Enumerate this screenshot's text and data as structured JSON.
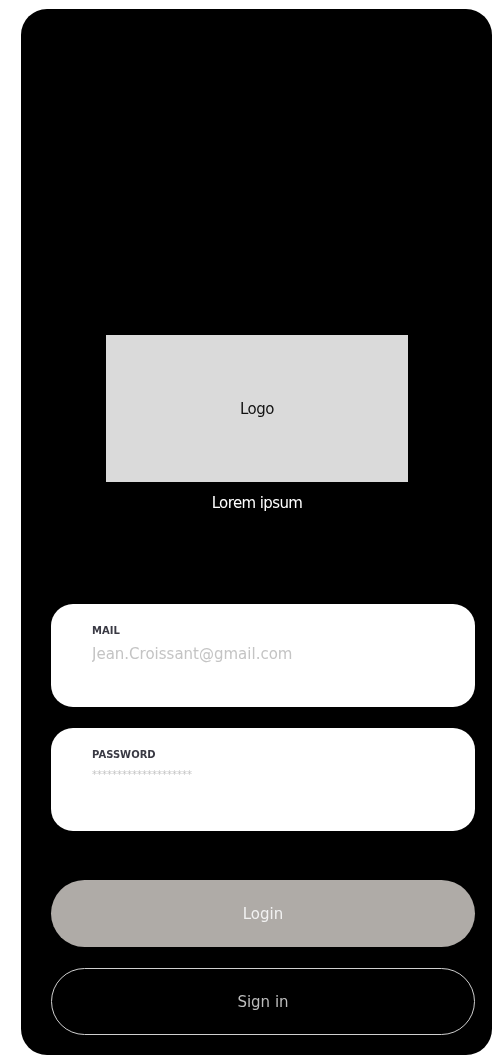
{
  "logo": {
    "label": "Logo"
  },
  "tagline": "Lorem ipsum",
  "fields": [
    {
      "label": "MAIL",
      "placeholder": "Jean.Croissant@gmail.com",
      "kind": "text"
    },
    {
      "label": "PASSWORD",
      "placeholder": "********************",
      "kind": "password"
    }
  ],
  "buttons": [
    {
      "label": "Login",
      "kind": "filled"
    },
    {
      "label": "Sign in",
      "kind": "outline"
    }
  ]
}
